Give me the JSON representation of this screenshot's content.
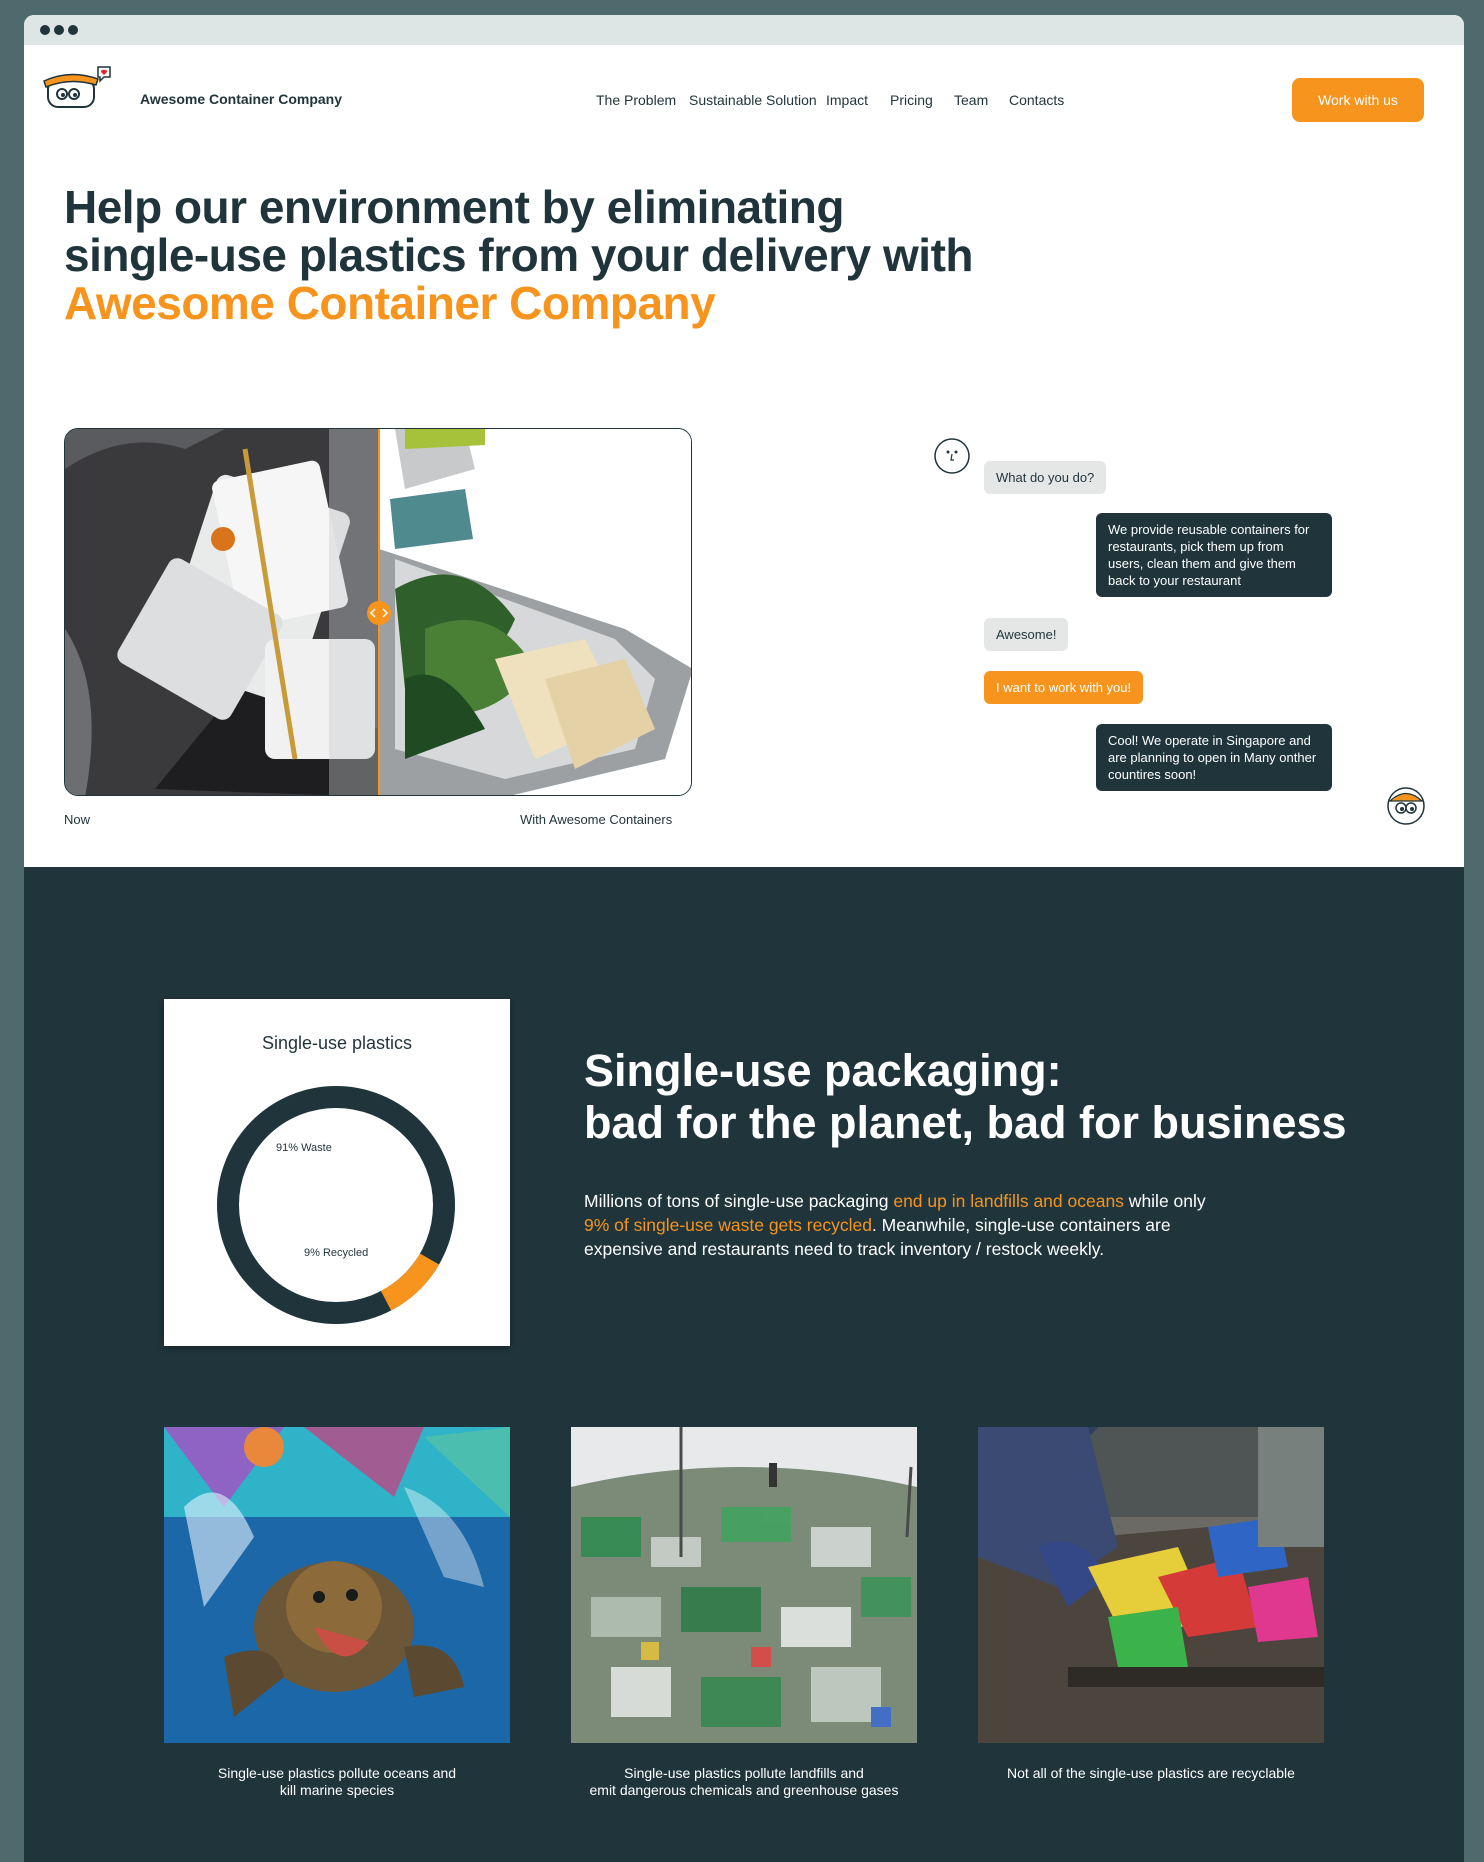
{
  "nav": {
    "brand": "Awesome Container Company",
    "items": [
      "The Problem",
      "Sustainable Solution",
      "Impact",
      "Pricing",
      "Team",
      "Contacts"
    ],
    "cta": "Work with us"
  },
  "hero": {
    "line1": "Help our environment by eliminating",
    "line2": "single-use plastics from your delivery with",
    "line3": "Awesome Container Company"
  },
  "compare": {
    "left_caption": "Now",
    "right_caption": "With Awesome Containers"
  },
  "chat": {
    "q1": "What do you do?",
    "a1": "We provide reusable containers for restaurants, pick them up from users, clean them and give them back to your restaurant",
    "q2": "Awesome!",
    "q3": "I want to work with you!",
    "a2": "Cool! We operate in Singapore and are planning to open in Many onther countires soon!"
  },
  "problem": {
    "title_line1": "Single-use packaging:",
    "title_line2": "bad for the planet, bad for business",
    "para_1": "Millions of tons of single-use packaging ",
    "para_hl1": "end up in landfills and oceans",
    "para_2": " while only ",
    "para_hl2": "9% of single-use waste gets recycled",
    "para_3": ". Meanwhile, single-use containers are expensive and restaurants need to track inventory / restock weekly."
  },
  "chart_data": {
    "type": "pie",
    "title": "Single-use plastics",
    "labels": [
      "91% Waste",
      "9% Recycled"
    ],
    "values": [
      91,
      9
    ],
    "colors": [
      "#1f343b",
      "#f7941d"
    ]
  },
  "photos": [
    {
      "caption_l1": "Single-use plastics pollute oceans and",
      "caption_l2": "kill marine species"
    },
    {
      "caption_l1": "Single-use plastics pollute landfills and",
      "caption_l2": "emit dangerous chemicals and greenhouse gases"
    },
    {
      "caption_l1": "Not all of the single-use plastics are recyclable",
      "caption_l2": ""
    }
  ],
  "colors": {
    "accent": "#f7941d",
    "dark": "#1f343b"
  }
}
